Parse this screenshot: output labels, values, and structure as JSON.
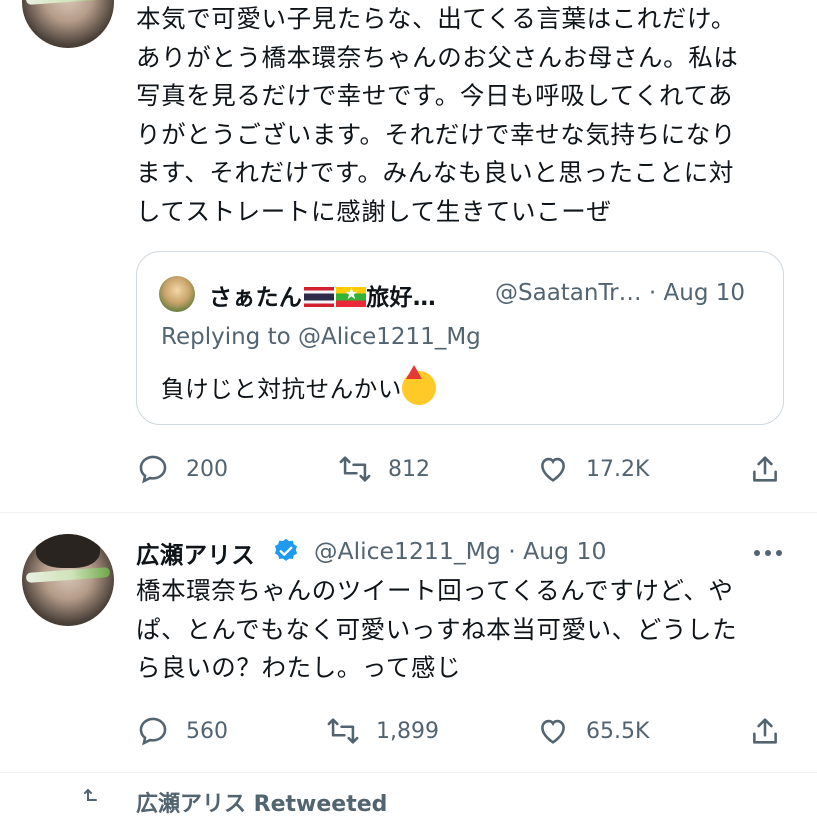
{
  "tweet1": {
    "text": "本気で可愛い子見たらな、出てくる言葉はこれだけ。\nありがとう橋本環奈ちゃんのお父さんお母さん。私は\n写真を見るだけで幸せです。今日も呼吸してくれてあ\nりがとうございます。それだけで幸せな気持ちになり\nます、それだけです。みんなも良いと思ったことに対\nしてストレートに感謝して生きていこーぜ",
    "quote": {
      "name": "さぁたん",
      "name_suffix": "旅好…",
      "handle_date": "@SaatanTr… · Aug 10",
      "replying": "Replying to @Alice1211_Mg",
      "text": "負けじと対抗せんかい"
    },
    "replies": "200",
    "retweets": "812",
    "likes": "17.2K"
  },
  "tweet2": {
    "name": "広瀬アリス",
    "meta": "@Alice1211_Mg · Aug 10",
    "text": "橋本環奈ちゃんのツイート回ってくるんですけど、や\nぱ、とんでもなく可愛いっすね本当可愛い、どうした\nら良いの？わたし。って感じ",
    "replies": "560",
    "retweets": "1,899",
    "likes": "65.5K"
  },
  "next": {
    "partial": "広瀬アリス Retweeted"
  },
  "colors": {
    "text": "#0f1419",
    "secondary": "#536471",
    "border": "#cfd9de",
    "verified": "#1d9bf0"
  }
}
